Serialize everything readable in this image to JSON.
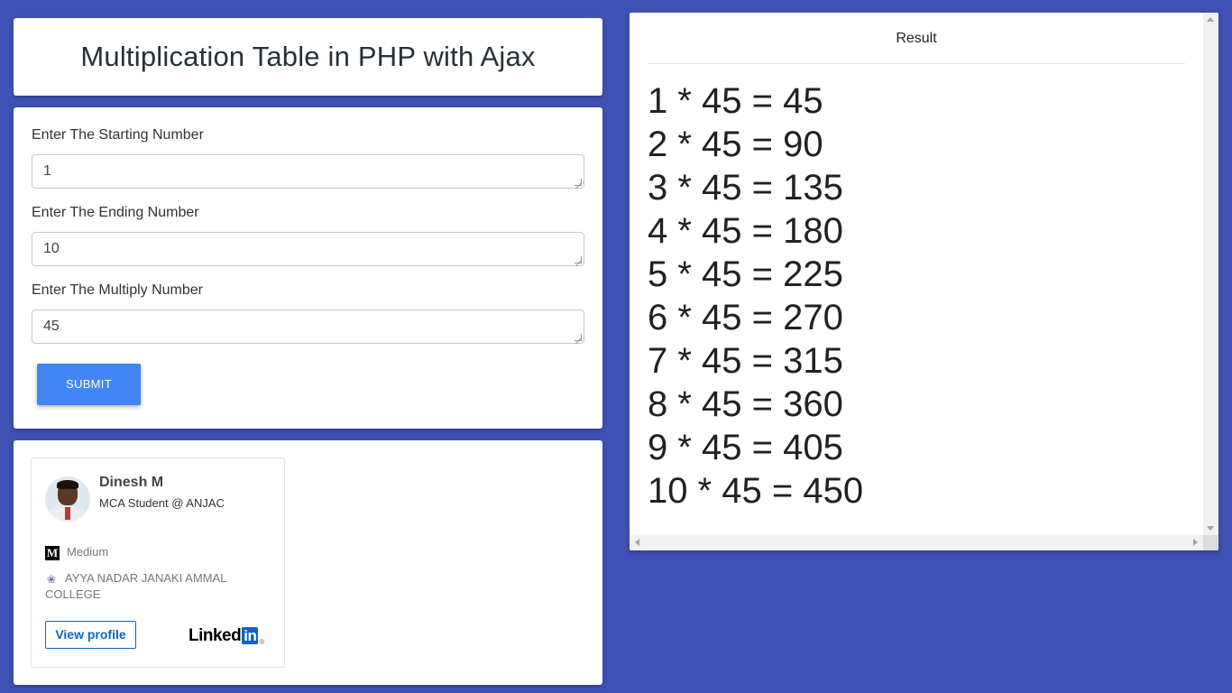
{
  "header": {
    "title": "Multiplication Table in PHP with Ajax"
  },
  "form": {
    "start_label": "Enter The Starting Number",
    "start_value": "1",
    "end_label": "Enter The Ending Number",
    "end_value": "10",
    "multiply_label": "Enter The Multiply Number",
    "multiply_value": "45",
    "submit_label": "SUBMIT"
  },
  "profile": {
    "name": "Dinesh M",
    "headline": "MCA Student @ ANJAC",
    "link_medium": "Medium",
    "college_line1": "AYYA NADAR JANAKI AMMAL",
    "college_line2": "COLLEGE",
    "view_profile_label": "View profile",
    "brand_linked": "Linked",
    "brand_in": "in",
    "brand_reg": "®"
  },
  "result": {
    "title": "Result",
    "lines": [
      "1 * 45 = 45",
      "2 * 45 = 90",
      "3 * 45 = 135",
      "4 * 45 = 180",
      "5 * 45 = 225",
      "6 * 45 = 270",
      "7 * 45 = 315",
      "8 * 45 = 360",
      "9 * 45 = 405",
      "10 * 45 = 450"
    ]
  },
  "colors": {
    "background": "#3f51b5",
    "submit_button": "#4285f4",
    "linkedin_blue": "#0a66c2"
  }
}
